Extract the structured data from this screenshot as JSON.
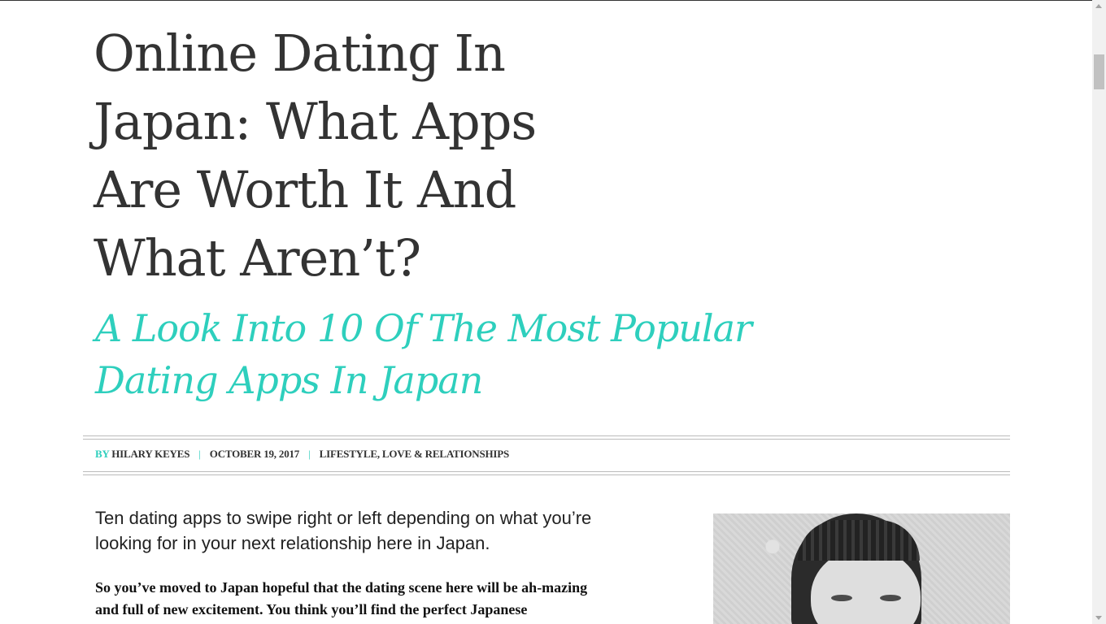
{
  "article": {
    "title": "Online Dating In Japan: What Apps Are Worth It And What Aren’t?",
    "subtitle": "A Look Into 10 Of The Most Popular Dating Apps In Japan",
    "meta": {
      "by_label": "BY",
      "author": "HILARY KEYES",
      "separator": "|",
      "date": "OCTOBER 19, 2017",
      "categories": "LIFESTYLE, LOVE & RELATIONSHIPS"
    },
    "lede": "Ten dating apps to swipe right or left depending on what you’re looking for in your next relationship here in Japan.",
    "body_intro": "So you’ve moved to Japan hopeful that the dating scene here will be ah-mazing and full of new excitement. You think you’ll find the perfect Japanese"
  },
  "colors": {
    "accent": "#2ecfbd",
    "title": "#333333"
  }
}
